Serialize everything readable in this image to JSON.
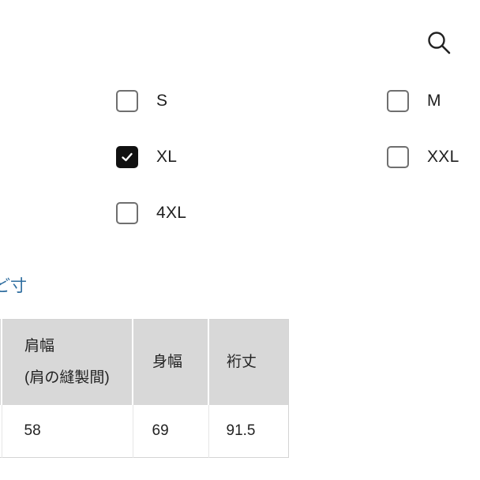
{
  "header": {
    "search_icon": "search-icon"
  },
  "size_options": [
    {
      "label": "S",
      "checked": false
    },
    {
      "label": "M",
      "checked": false
    },
    {
      "label": "XL",
      "checked": true
    },
    {
      "label": "XXL",
      "checked": false
    },
    {
      "label": "4XL",
      "checked": false
    }
  ],
  "section": {
    "link_text": "ど寸"
  },
  "size_table": {
    "headers": [
      {
        "line1": "肩幅",
        "line2": "(肩の縫製間)"
      },
      {
        "line1": "身幅"
      },
      {
        "line1": "裄丈"
      }
    ],
    "rows": [
      [
        "58",
        "69",
        "91.5"
      ]
    ]
  },
  "colors": {
    "checkbox_border": "#6f6f6f",
    "checkbox_checked": "#111111",
    "link": "#2e6d9f",
    "table_header_bg": "#d8d8d8"
  }
}
